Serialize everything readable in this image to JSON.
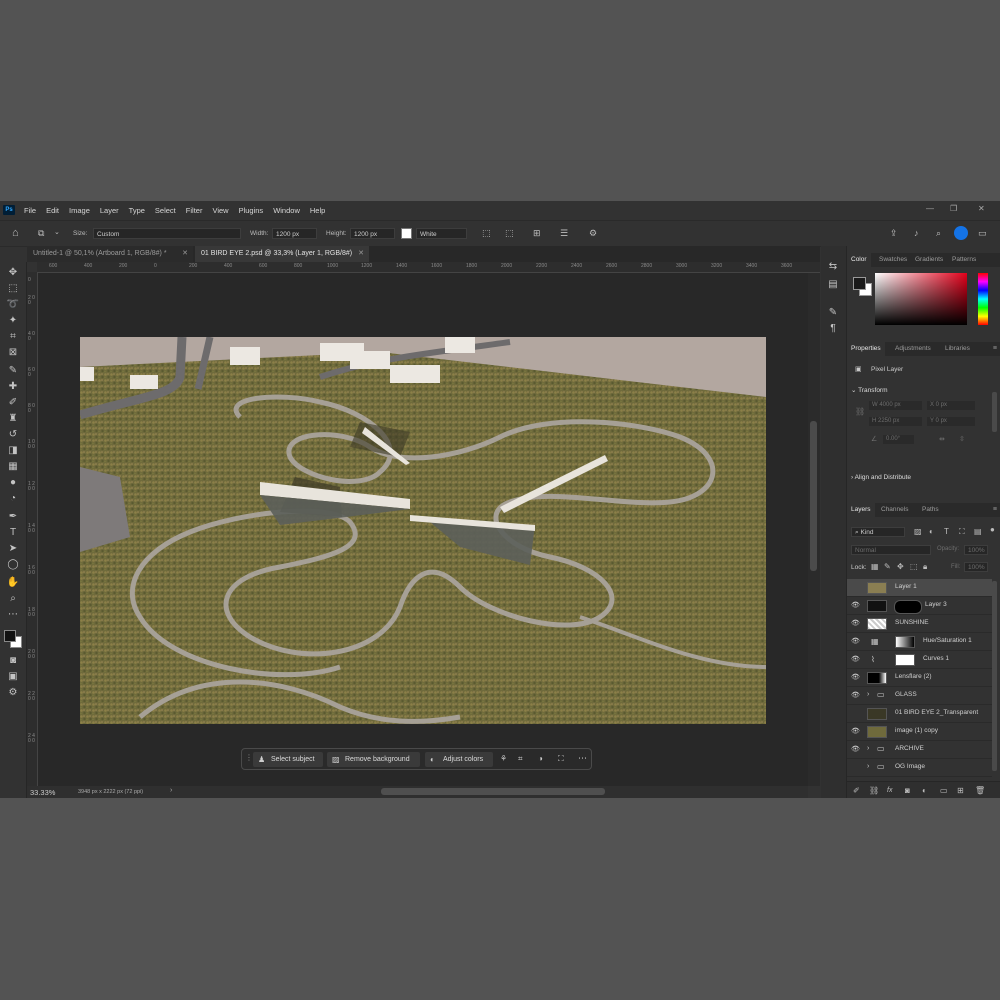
{
  "app": {
    "logo": "Ps"
  },
  "menu": [
    "File",
    "Edit",
    "Image",
    "Layer",
    "Type",
    "Select",
    "Filter",
    "View",
    "Plugins",
    "Window",
    "Help"
  ],
  "options": {
    "size_label": "Size:",
    "size_value": "Custom",
    "width_label": "Width:",
    "width_value": "1200 px",
    "height_label": "Height:",
    "height_value": "1200 px",
    "fill_value": "White"
  },
  "tabs": [
    {
      "label": "Untitled-1 @ 50,1% (Artboard 1, RGB/8#) *"
    },
    {
      "label": "01 BIRD EYE 2.psd @ 33,3% (Layer 1, RGB/8#)"
    }
  ],
  "ruler": [
    "600",
    "400",
    "200",
    "0",
    "200",
    "400",
    "600",
    "800",
    "1000",
    "1200",
    "1400",
    "1600",
    "1800",
    "2000",
    "2200",
    "2400",
    "2600",
    "2800",
    "3000",
    "3200",
    "3400",
    "3600",
    "3800",
    "4000",
    "4200"
  ],
  "vruler": [
    "0",
    "2 0 0",
    "4 0 0",
    "6 0 0",
    "8 0 0",
    "1 0 0 0",
    "1 2 0 0",
    "1 4 0 0",
    "1 6 0 0",
    "1 8 0 0",
    "2 0 0 0",
    "2 2 0 0",
    "2 4 0 0"
  ],
  "status": {
    "zoom": "33.33%",
    "doc_size": "3948 px x 2222 px (72 ppi)"
  },
  "ctxbar": {
    "select_subject": "Select subject",
    "remove_background": "Remove background",
    "adjust_colors": "Adjust colors"
  },
  "color_panel": {
    "tabs": [
      "Color",
      "Swatches",
      "Gradients",
      "Patterns"
    ],
    "fg": "#1a1a1a",
    "bg": "#ffffff"
  },
  "properties": {
    "tabs": [
      "Properties",
      "Adjustments",
      "Libraries"
    ],
    "type": "Pixel Layer",
    "transform": "Transform",
    "w": "W  4000 px",
    "h": "H  2250 px",
    "x": "X  0 px",
    "y": "Y  0 px",
    "angle": "0.00°",
    "align": "Align and Distribute"
  },
  "layers": {
    "tabs": [
      "Layers",
      "Channels",
      "Paths"
    ],
    "kind": "Kind",
    "blend": "Normal",
    "opacity_label": "Opacity:",
    "opacity": "100%",
    "lock_label": "Lock:",
    "fill_label": "Fill:",
    "fill": "100%",
    "items": [
      {
        "name": "Layer 1",
        "visible": false,
        "selected": true
      },
      {
        "name": "Layer 3",
        "visible": true
      },
      {
        "name": "SUNSHINE",
        "visible": true
      },
      {
        "name": "Hue/Saturation 1",
        "visible": true
      },
      {
        "name": "Curves 1",
        "visible": true
      },
      {
        "name": "Lensflare (2)",
        "visible": true
      },
      {
        "name": "GLASS",
        "visible": true,
        "folder": true
      },
      {
        "name": "01 BIRD EYE 2_Transparent",
        "visible": false
      },
      {
        "name": "image (1) copy",
        "visible": true
      },
      {
        "name": "ARCHIVE",
        "visible": true,
        "folder": true
      },
      {
        "name": "OG Image",
        "visible": false,
        "folder": true
      }
    ]
  }
}
